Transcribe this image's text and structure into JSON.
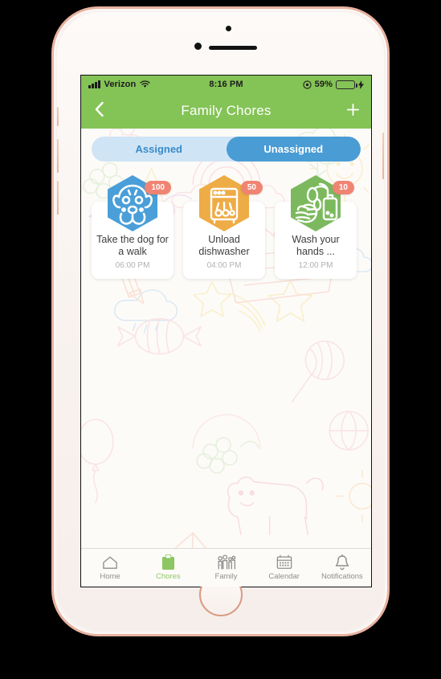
{
  "device": {
    "frame_color": "#e8b3a0",
    "home_button": "home-button"
  },
  "status_bar": {
    "carrier": "Verizon",
    "signal_icon": "signal-bars-icon",
    "wifi_icon": "wifi-icon",
    "time": "8:16 PM",
    "location_icon": "location-services-icon",
    "battery_percent": "59%",
    "battery_level": 59,
    "charging_icon": "charging-bolt-icon",
    "bg_color": "#84c356"
  },
  "navbar": {
    "back_icon": "chevron-left-icon",
    "title": "Family Chores",
    "add_icon": "plus-icon",
    "add_label": "+",
    "bg_color": "#84c356"
  },
  "segmented_control": {
    "track_color": "#cfe4f5",
    "active_color": "#4a9cd4",
    "options": [
      {
        "label": "Assigned",
        "active": false
      },
      {
        "label": "Unassigned",
        "active": true
      }
    ]
  },
  "chores": [
    {
      "title": "Take the dog for a walk",
      "time": "06:00 PM",
      "points": "100",
      "icon": "dog-face-icon",
      "hex_color": "#4a9fd8",
      "badge_color": "#f08472"
    },
    {
      "title": "Unload dishwasher",
      "time": "04:00 PM",
      "points": "50",
      "icon": "dishwasher-icon",
      "hex_color": "#eeac46",
      "badge_color": "#f08472"
    },
    {
      "title": "Wash your hands ...",
      "time": "12:00 PM",
      "points": "10",
      "icon": "washing-hands-icon",
      "hex_color": "#7cb95e",
      "badge_color": "#f08472"
    }
  ],
  "tabbar": {
    "active_color": "#8cc763",
    "inactive_color": "#8e8e8e",
    "items": [
      {
        "label": "Home",
        "icon": "house-icon",
        "active": false
      },
      {
        "label": "Chores",
        "icon": "clipboard-icon",
        "active": true
      },
      {
        "label": "Family",
        "icon": "people-group-icon",
        "active": false
      },
      {
        "label": "Calendar",
        "icon": "calendar-icon",
        "active": false
      },
      {
        "label": "Notifications",
        "icon": "bell-icon",
        "active": false
      }
    ]
  }
}
